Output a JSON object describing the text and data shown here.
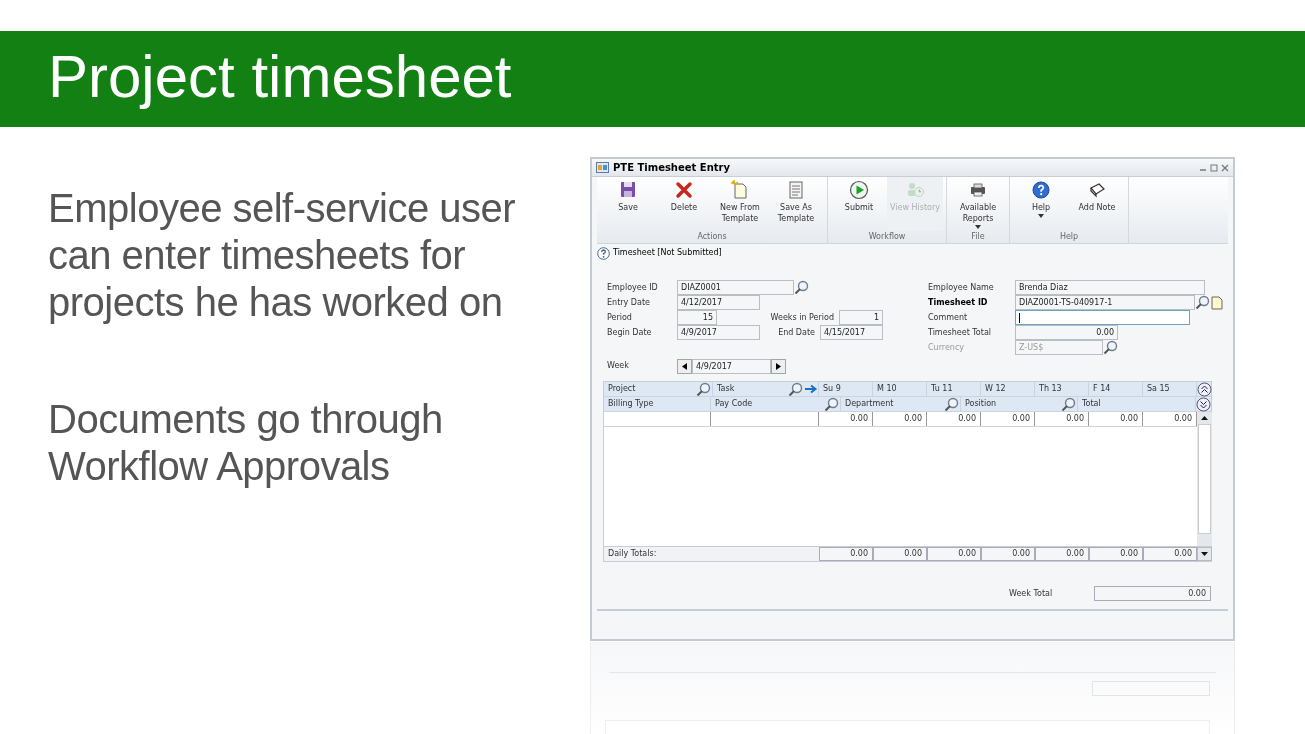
{
  "slide": {
    "title": "Project timesheet",
    "paragraphs": [
      "Employee self-service user can enter timesheets for projects he has worked on",
      "Documents go through Workflow Approvals"
    ]
  },
  "window": {
    "title": "PTE Timesheet Entry"
  },
  "ribbon": {
    "groups": [
      {
        "label": "Actions",
        "buttons": [
          {
            "label": "Save",
            "kind": "save",
            "disabled": false,
            "dropdown": false
          },
          {
            "label": "Delete",
            "kind": "delete",
            "disabled": false,
            "dropdown": false
          },
          {
            "label": "New From Template",
            "kind": "new",
            "disabled": false,
            "dropdown": false
          },
          {
            "label": "Save As Template",
            "kind": "template",
            "disabled": false,
            "dropdown": false
          }
        ]
      },
      {
        "label": "Workflow",
        "buttons": [
          {
            "label": "Submit",
            "kind": "submit",
            "disabled": false,
            "dropdown": false
          },
          {
            "label": "View History",
            "kind": "history",
            "disabled": true,
            "dropdown": false
          }
        ]
      },
      {
        "label": "File",
        "buttons": [
          {
            "label": "Available Reports",
            "kind": "reports",
            "disabled": false,
            "dropdown": true
          }
        ]
      },
      {
        "label": "Help",
        "buttons": [
          {
            "label": "Help",
            "kind": "help",
            "disabled": false,
            "dropdown": true
          },
          {
            "label": "Add Note",
            "kind": "note",
            "disabled": false,
            "dropdown": false
          }
        ]
      }
    ]
  },
  "status": "Timesheet [Not Submitted]",
  "fields": {
    "employee_id": {
      "label": "Employee ID",
      "value": "DIAZ0001"
    },
    "entry_date": {
      "label": "Entry Date",
      "value": "4/12/2017"
    },
    "period": {
      "label": "Period",
      "value": "15"
    },
    "weeks_in_period": {
      "label": "Weeks in Period",
      "value": "1"
    },
    "begin_date": {
      "label": "Begin Date",
      "value": "4/9/2017"
    },
    "end_date": {
      "label": "End Date",
      "value": "4/15/2017"
    },
    "week": {
      "label": "Week",
      "value": "4/9/2017"
    },
    "employee_name": {
      "label": "Employee Name",
      "value": "Brenda  Diaz"
    },
    "timesheet_id": {
      "label": "Timesheet ID",
      "value": "DIAZ0001-TS-040917-1",
      "required": true
    },
    "comment": {
      "label": "Comment",
      "focused": true
    },
    "timesheet_total": {
      "label": "Timesheet Total",
      "value": "0.00"
    },
    "currency": {
      "label": "Currency",
      "value": "Z-US$",
      "disabled": true
    }
  },
  "grid": {
    "header_row_1": [
      {
        "label": "Project",
        "lookup": true,
        "arrow": false
      },
      {
        "label": "Task",
        "lookup": true,
        "arrow": true
      },
      {
        "label": "Su 9",
        "lookup": false,
        "arrow": false
      },
      {
        "label": "M 10",
        "lookup": false,
        "arrow": false
      },
      {
        "label": "Tu 11",
        "lookup": false,
        "arrow": false
      },
      {
        "label": "W 12",
        "lookup": false,
        "arrow": false
      },
      {
        "label": "Th 13",
        "lookup": false,
        "arrow": false
      },
      {
        "label": "F 14",
        "lookup": false,
        "arrow": false
      },
      {
        "label": "Sa 15",
        "lookup": false,
        "arrow": false
      }
    ],
    "header_row_2": [
      {
        "label": "Billing Type",
        "lookup": false
      },
      {
        "label": "Pay Code",
        "lookup": true
      },
      {
        "label": "Department",
        "lookup": true
      },
      {
        "label": "Position",
        "lookup": true
      },
      {
        "label": "Total",
        "lookup": false
      }
    ],
    "rows": [
      {
        "hours": [
          "0.00",
          "0.00",
          "0.00",
          "0.00",
          "0.00",
          "0.00",
          "0.00"
        ]
      }
    ],
    "daily_totals_label": "Daily Totals:",
    "daily_totals": [
      "0.00",
      "0.00",
      "0.00",
      "0.00",
      "0.00",
      "0.00",
      "0.00"
    ]
  },
  "week_total": {
    "label": "Week Total",
    "value": "0.00"
  }
}
